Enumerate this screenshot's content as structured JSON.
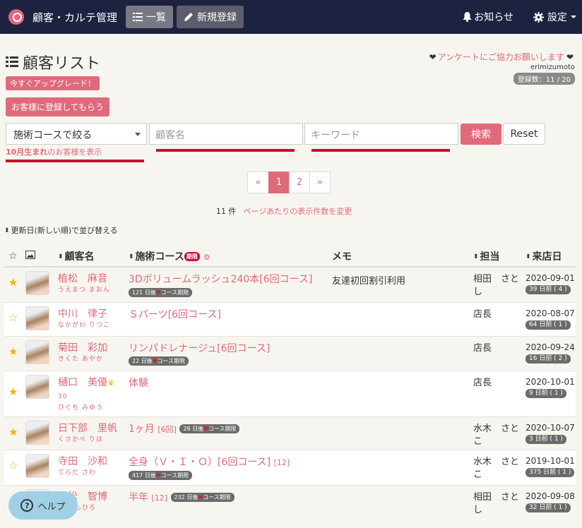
{
  "nav": {
    "title": "顧客・カルテ管理",
    "list_btn": "一覧",
    "new_btn": "新規登録",
    "notice": "お知らせ",
    "settings": "設定"
  },
  "header": {
    "title": "顧客リスト",
    "survey": "アンケートにご協力お願いします",
    "user": "erimizumoto",
    "registered": "登録数：11 / 20"
  },
  "buttons": {
    "upgrade": "今すぐアップグレード！",
    "register": "お客様に登録してもらう",
    "search": "検索",
    "reset": "Reset"
  },
  "filters": {
    "course_select": "施術コースで絞る",
    "name_placeholder": "顧客名",
    "keyword_placeholder": "キーワード",
    "birthday_bold": "10月生まれ",
    "birthday_rest": "のお客様を表示"
  },
  "pager": {
    "prev": "«",
    "p1": "1",
    "p2": "2",
    "next": "»"
  },
  "count": {
    "num": "11 件",
    "per_page": "ページあたりの表示件数を変更"
  },
  "sort_note": "更新日(新しい順)で並び替える",
  "columns": {
    "name": "顧客名",
    "course": "施術コース",
    "limit": "期限",
    "memo": "メモ",
    "staff": "担当",
    "visit": "来店日"
  },
  "rows": [
    {
      "name": "植松　麻音",
      "kana": "うえまつ まおん",
      "course": "3Dボリュームラッシュ240本[6回コース]",
      "course_extra": "",
      "pill": "121 日後",
      "memo": "友達初回割引利用",
      "staff": "相田　さとし",
      "date": "2020-09-01",
      "ago": "39 日前 ( 4 )"
    },
    {
      "name": "中川　律子",
      "kana": "なかがわ りつこ",
      "course": "Ｓパーツ[6回コース]",
      "course_extra": "",
      "pill": "",
      "memo": "",
      "staff": "店長",
      "date": "2020-08-07",
      "ago": "64 日前 ( 1 )"
    },
    {
      "name": "菊田　彩加",
      "kana": "きくた あやか",
      "course": "リンパドレナージュ[6回コース]",
      "course_extra": "",
      "pill": "22 日後",
      "memo": "",
      "staff": "店長",
      "date": "2020-09-24",
      "ago": "16 日前 ( 2 )"
    },
    {
      "name": "樋口　美優",
      "kana": "ひぐち みゆう",
      "age": "30",
      "course": "体験",
      "course_extra": "",
      "pill": "",
      "memo": "",
      "staff": "店長",
      "date": "2020-10-01",
      "ago": "9 日前 ( 1 )"
    },
    {
      "name": "日下部　里帆",
      "kana": "くさかべ りほ",
      "course": "1ヶ月",
      "course_extra": "[6回]",
      "pill": "28 日後",
      "memo": "",
      "staff": "水木　さとこ",
      "date": "2020-10-07",
      "ago": "3 日前 ( 1 )"
    },
    {
      "name": "寺田　沙和",
      "kana": "てらだ さわ",
      "course": "全身（Ｖ・Ｉ・Ｏ）[6回コース]",
      "course_extra": "[12]",
      "pill": "417 日後",
      "memo": "",
      "staff": "水木　さとこ",
      "date": "2019-10-01",
      "ago": "375 日前 ( 1 )"
    },
    {
      "name": "　松　智博",
      "kana": "つ ともひろ",
      "course": "半年",
      "course_extra": "[12]",
      "pill": "232 日後",
      "memo": "",
      "staff": "相田　さとし",
      "date": "2020-09-08",
      "ago": "32 日前 ( 1 )"
    }
  ],
  "pill_suffix": "コース期限",
  "help": "ヘルプ"
}
